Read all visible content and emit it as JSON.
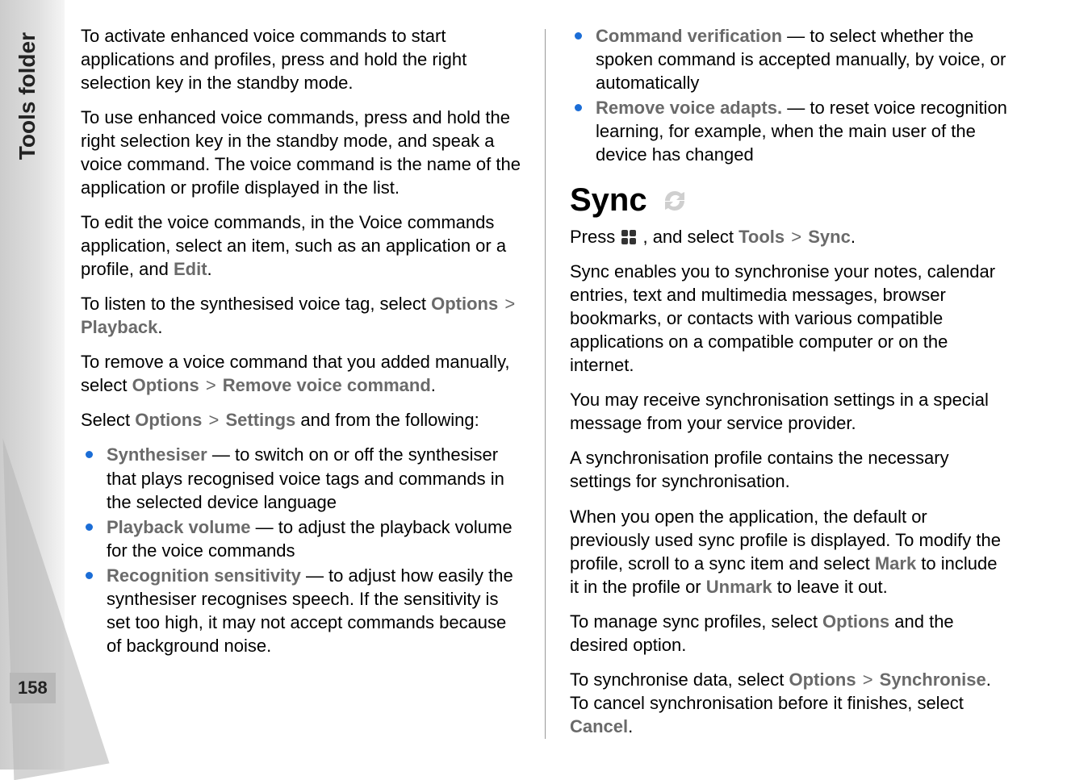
{
  "sidebar": {
    "tab_label": "Tools folder",
    "page_number": "158"
  },
  "left_col": {
    "p1": "To activate enhanced voice commands to start applications and profiles, press and hold the right selection key in the standby mode.",
    "p2": "To use enhanced voice commands, press and hold the right selection key in the standby mode, and speak a voice command. The voice command is the name of the application or profile displayed in the list.",
    "p3_pre": "To edit the voice commands, in the Voice commands application, select an item, such as an application or a profile, and ",
    "p3_term": "Edit",
    "p3_post": ".",
    "p4_pre": "To listen to the synthesised voice tag, select ",
    "p4_opt": "Options",
    "p4_play": "Playback",
    "p4_post": ".",
    "p5_pre": "To remove a voice command that you added manually, select ",
    "p5_opt": "Options",
    "p5_rem": "Remove voice command",
    "p5_post": ".",
    "p6_pre": "Select ",
    "p6_opt": "Options",
    "p6_set": "Settings",
    "p6_post": " and from the following:",
    "bullets": [
      {
        "term": "Synthesiser",
        "desc": " — to switch on or off the synthesiser that plays recognised voice tags and commands in the selected device language"
      },
      {
        "term": "Playback volume",
        "desc": " — to adjust the playback volume for the voice commands"
      },
      {
        "term": "Recognition sensitivity",
        "desc": " — to adjust how easily the synthesiser recognises speech. If the sensitivity is set too high, it may not accept commands because of background noise."
      }
    ]
  },
  "right_col": {
    "top_bullets": [
      {
        "term": "Command verification",
        "desc": " — to select whether the spoken command is accepted manually, by voice, or automatically"
      },
      {
        "term": "Remove voice adapts.",
        "desc": " — to reset voice recognition learning, for example, when the main user of the device has changed"
      }
    ],
    "sync_heading": "Sync",
    "sync_press_pre": "Press ",
    "sync_press_mid": " , and select ",
    "sync_tools": "Tools",
    "sync_sync": "Sync",
    "sync_press_post": ".",
    "p1": "Sync enables you to synchronise your notes, calendar entries, text and multimedia messages, browser bookmarks, or contacts with various compatible applications on a compatible computer or on the internet.",
    "p2": "You may receive synchronisation settings in a special message from your service provider.",
    "p3": "A synchronisation profile contains the necessary settings for synchronisation.",
    "p4_pre": "When you open the application, the default or previously used sync profile is displayed. To modify the profile, scroll to a sync item and select ",
    "p4_mark": "Mark",
    "p4_mid": " to include it in the profile or ",
    "p4_unmark": "Unmark",
    "p4_post": " to leave it out.",
    "p5_pre": "To manage sync profiles, select ",
    "p5_opt": "Options",
    "p5_post": " and the desired option.",
    "p6_pre": "To synchronise data, select ",
    "p6_opt": "Options",
    "p6_sync": "Synchronise",
    "p6_mid": ". To cancel synchronisation before it finishes, select ",
    "p6_cancel": "Cancel",
    "p6_post": "."
  }
}
